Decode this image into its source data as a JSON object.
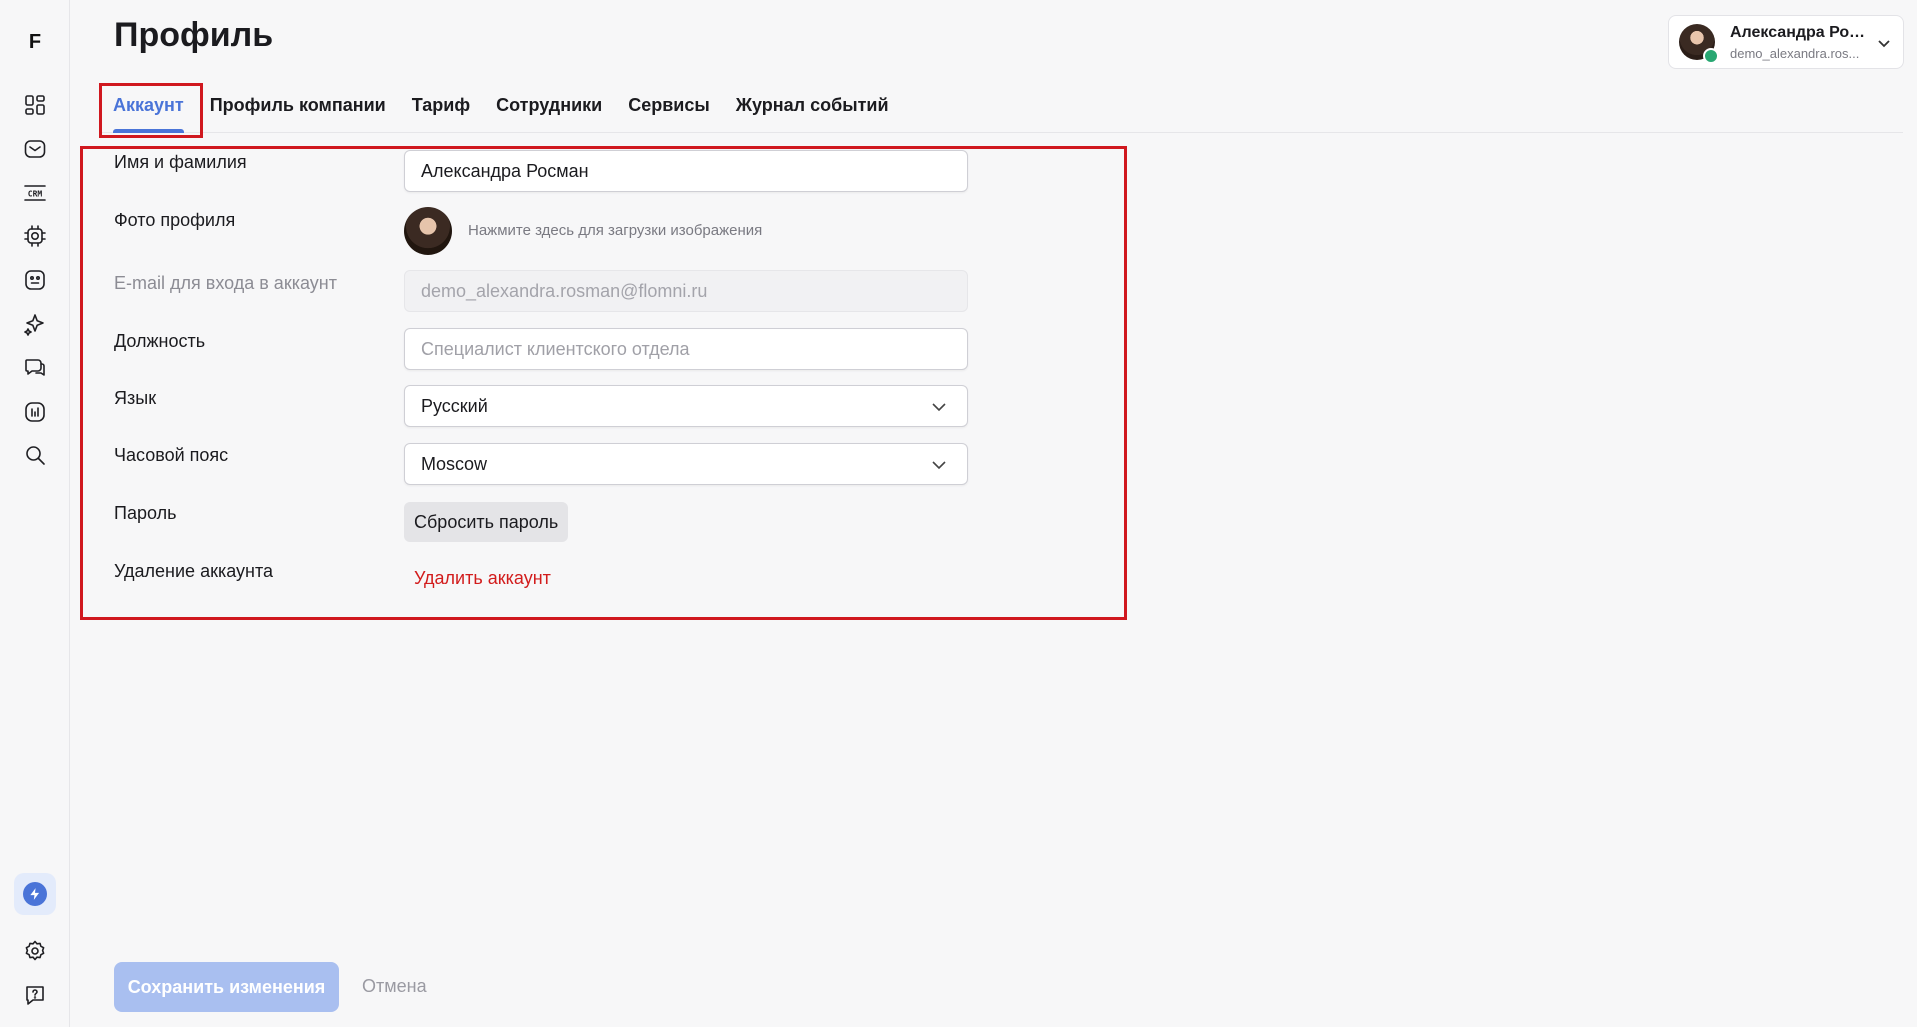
{
  "sidebar": {
    "logo": "F",
    "icons": [
      "dashboard-icon",
      "mail-icon",
      "crm-icon",
      "chip-icon",
      "bot-icon",
      "sparkle-icon",
      "chat-icon",
      "analytics-icon",
      "search-icon",
      "boost-icon",
      "settings-icon",
      "help-icon"
    ],
    "crm_text": "CRM"
  },
  "header": {
    "title": "Профиль"
  },
  "user": {
    "name": "Александра Рос...",
    "login": "demo_alexandra.ros..."
  },
  "tabs": [
    {
      "label": "Аккаунт",
      "active": true
    },
    {
      "label": "Профиль компании"
    },
    {
      "label": "Тариф"
    },
    {
      "label": "Сотрудники"
    },
    {
      "label": "Сервисы"
    },
    {
      "label": "Журнал событий"
    }
  ],
  "form": {
    "name": {
      "label": "Имя и фамилия",
      "value": "Александра Росман"
    },
    "photo": {
      "label": "Фото профиля",
      "hint": "Нажмите здесь для загрузки изображения"
    },
    "email": {
      "label": "E-mail для входа в аккаунт",
      "value": "demo_alexandra.rosman@flomni.ru"
    },
    "position": {
      "label": "Должность",
      "placeholder": "Специалист клиентского отдела"
    },
    "language": {
      "label": "Язык",
      "value": "Русский"
    },
    "timezone": {
      "label": "Часовой пояс",
      "value": "Moscow"
    },
    "password": {
      "label": "Пароль",
      "button": "Сбросить пароль"
    },
    "delete": {
      "label": "Удаление аккаунта",
      "link": "Удалить аккаунт"
    }
  },
  "footer": {
    "save": "Сохранить изменения",
    "cancel": "Отмена"
  },
  "colors": {
    "accent": "#4a74d8",
    "danger": "#d21c1c",
    "highlight": "#d0181f",
    "online": "#28a772"
  }
}
